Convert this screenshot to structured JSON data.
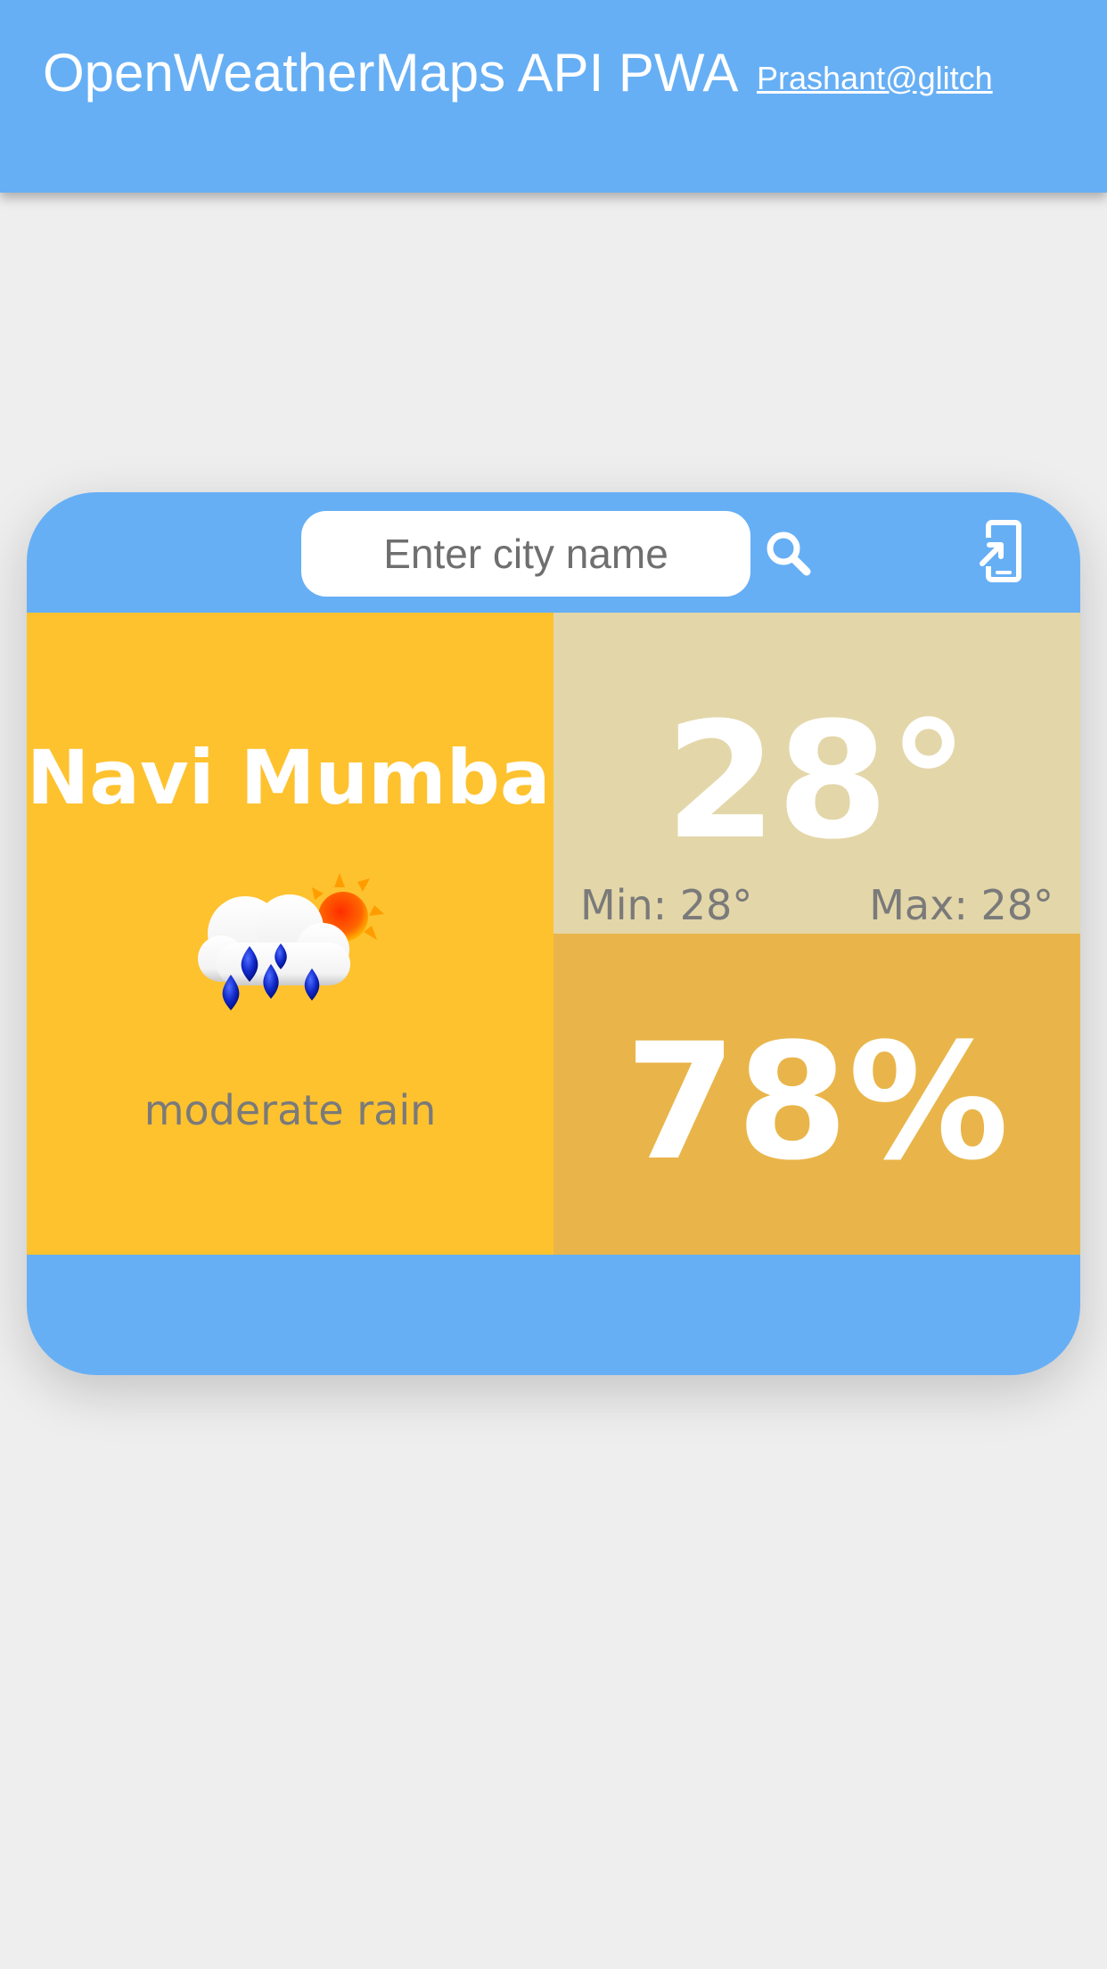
{
  "header": {
    "title": "OpenWeatherMaps API PWA",
    "author_link": "Prashant@glitch"
  },
  "search": {
    "placeholder": "Enter city name",
    "value": ""
  },
  "icons": {
    "search": "search-icon",
    "install": "add-to-home-screen-icon",
    "weather": "rain-cloud-with-sun-icon"
  },
  "weather": {
    "city": "Navi Mumbai",
    "description": "moderate rain",
    "temperature": "28°",
    "min": "Min: 28°",
    "max": "Max: 28°",
    "humidity": "78%"
  },
  "colors": {
    "primary": "#66aff5",
    "background": "#eeeeee",
    "city_panel": "#fec22f",
    "temperature_panel": "#e3d6a9",
    "humidity_panel": "#e9b54a",
    "muted_text": "#7a7a7a"
  }
}
